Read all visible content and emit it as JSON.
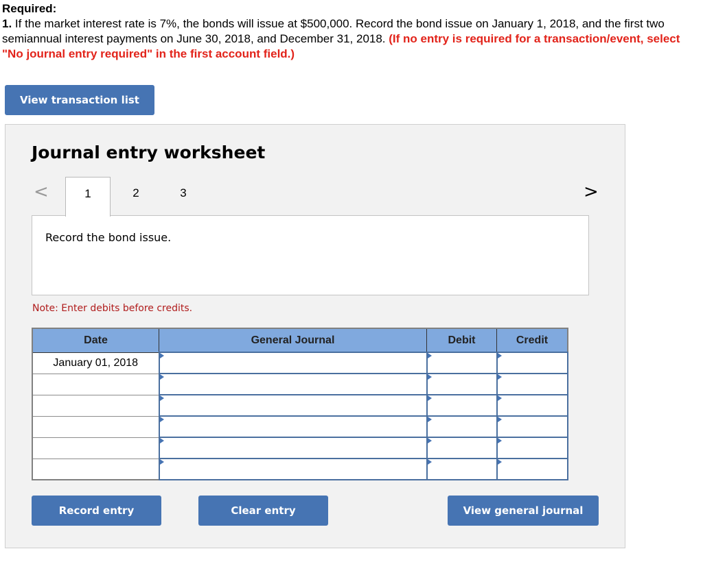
{
  "required": {
    "title": "Required:",
    "number": "1.",
    "text": " If the market interest rate is 7%, the bonds will issue at $500,000. Record the bond issue on January 1, 2018, and the first two semiannual interest payments on June 30, 2018, and December 31, 2018. ",
    "instruction": "(If no entry is required for a transaction/event, select \"No journal entry required\" in the first account field.)"
  },
  "buttons": {
    "view_transaction_list": "View transaction list",
    "record_entry": "Record entry",
    "clear_entry": "Clear entry",
    "view_general_journal": "View general journal"
  },
  "worksheet": {
    "title": "Journal entry worksheet",
    "nav_prev": "<",
    "nav_next": ">",
    "tabs": [
      {
        "label": "1",
        "active": true
      },
      {
        "label": "2",
        "active": false
      },
      {
        "label": "3",
        "active": false
      }
    ],
    "description": "Record the bond issue.",
    "note": "Note: Enter debits before credits."
  },
  "table": {
    "headers": [
      "Date",
      "General Journal",
      "Debit",
      "Credit"
    ],
    "rows": [
      {
        "date": "January 01, 2018",
        "account": "",
        "debit": "",
        "credit": ""
      },
      {
        "date": "",
        "account": "",
        "debit": "",
        "credit": ""
      },
      {
        "date": "",
        "account": "",
        "debit": "",
        "credit": ""
      },
      {
        "date": "",
        "account": "",
        "debit": "",
        "credit": ""
      },
      {
        "date": "",
        "account": "",
        "debit": "",
        "credit": ""
      },
      {
        "date": "",
        "account": "",
        "debit": "",
        "credit": ""
      }
    ]
  },
  "colors": {
    "button_blue": "#4674b3",
    "header_blue": "#80a9de",
    "instruction_red": "#e2231a",
    "note_red": "#b01c1c"
  }
}
